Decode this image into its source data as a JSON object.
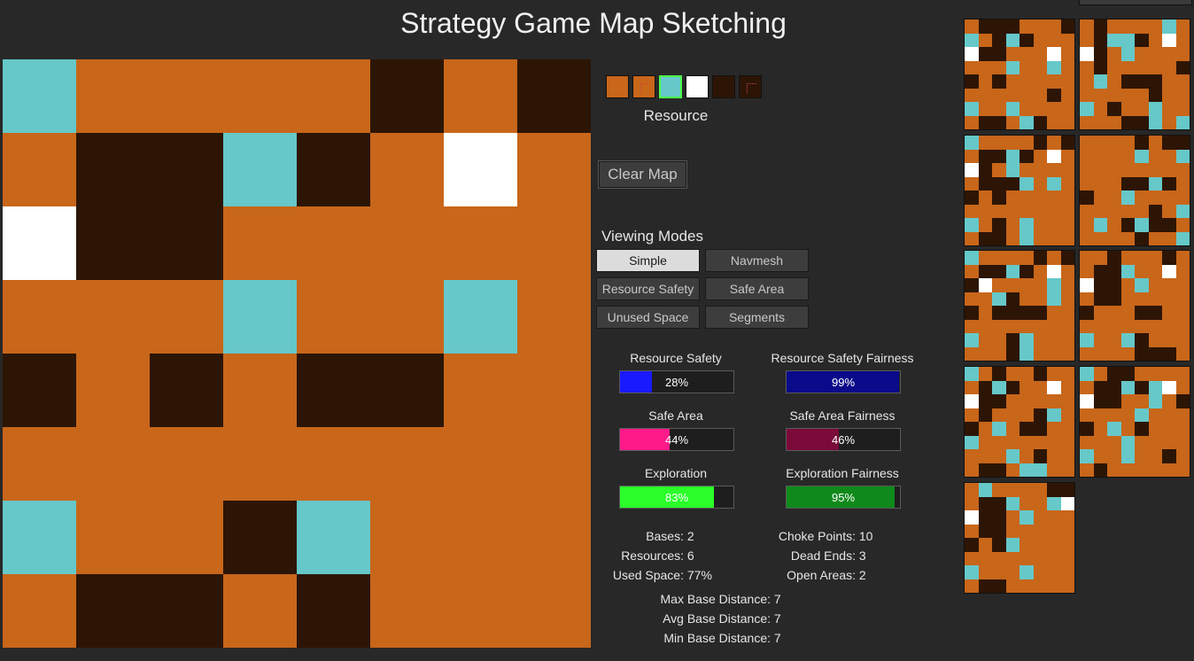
{
  "title": "Strategy Game Map Sketching",
  "tile_colors": {
    "O": "#c8661a",
    "D": "#2d1505",
    "C": "#66c8c8",
    "W": "#ffffff"
  },
  "main_map": [
    "COOOODOD",
    "ODDCDOWO",
    "WDDOOOOO",
    "OOOCOOCO",
    "DODODDOO",
    "OOOOOOOO",
    "COODCOOO",
    "ODDODOOO"
  ],
  "palette": {
    "label": "Resource",
    "tools": [
      {
        "name": "ground-tile",
        "color": "#c8661a",
        "selected": false,
        "marker": false
      },
      {
        "name": "ground-marker-tile",
        "color": "#c8661a",
        "selected": false,
        "marker": true
      },
      {
        "name": "resource-tile",
        "color": "#66c8c8",
        "selected": true,
        "marker": false
      },
      {
        "name": "base-tile",
        "color": "#ffffff",
        "selected": false,
        "marker": false
      },
      {
        "name": "wall-tile",
        "color": "#2d1505",
        "selected": false,
        "marker": false
      },
      {
        "name": "wall-marker-tile",
        "color": "#2d1505",
        "selected": false,
        "marker": true
      }
    ]
  },
  "clear_label": "Clear Map",
  "viewing_modes": {
    "label": "Viewing Modes",
    "buttons": [
      "Simple",
      "Navmesh",
      "Resource Safety",
      "Safe Area",
      "Unused Space",
      "Segments"
    ],
    "active": "Simple"
  },
  "metrics": [
    {
      "label": "Resource Safety",
      "value": 28,
      "text": "28%",
      "color": "#1a1aff"
    },
    {
      "label": "Resource Safety Fairness",
      "value": 99,
      "text": "99%",
      "color": "#0a0a8a"
    },
    {
      "label": "Safe Area",
      "value": 44,
      "text": "44%",
      "color": "#ff1a8a"
    },
    {
      "label": "Safe Area Fairness",
      "value": 46,
      "text": "46%",
      "color": "#7a0a3a"
    },
    {
      "label": "Exploration",
      "value": 83,
      "text": "83%",
      "color": "#2aff2a"
    },
    {
      "label": "Exploration Fairness",
      "value": 95,
      "text": "95%",
      "color": "#0f8a1a"
    }
  ],
  "stats_left": [
    {
      "k": "Bases:",
      "v": "2"
    },
    {
      "k": "Resources:",
      "v": "6"
    },
    {
      "k": "Used Space:",
      "v": "77%"
    }
  ],
  "stats_right": [
    {
      "k": "Choke Points:",
      "v": "10"
    },
    {
      "k": "Dead Ends:",
      "v": "3"
    },
    {
      "k": "Open Areas:",
      "v": "2"
    }
  ],
  "stats_bottom": [
    {
      "k": "Max Base Distance:",
      "v": "7"
    },
    {
      "k": "Avg Base Distance:",
      "v": "7"
    },
    {
      "k": "Min Base Distance:",
      "v": "7"
    }
  ],
  "thumbnails": [
    [
      "ODDDOOOD",
      "CODCDOOO",
      "WDDOOOWO",
      "OOOCOOCO",
      "DODOOOOO",
      "OOOOOODO",
      "COOCOOOO",
      "ODDOCDOO"
    ],
    [
      "ODOOOOCO",
      "ODCCDOWO",
      "WDOCOOOO",
      "ODOOOOOD",
      "OCODDDOO",
      "OOOOODOO",
      "CODOOCOO",
      "OOODDCOC"
    ],
    [
      "COOOODOD",
      "ODDCDOWO",
      "WDOCOOOO",
      "ODDDCOCO",
      "DODOOOOO",
      "OOOOOOOO",
      "CODOCOOO",
      "ODDOCOOO"
    ],
    [
      "OOOODODD",
      "OOOOCOOC",
      "OOOOOOOO",
      "OOODDCDO",
      "DOOCOOOO",
      "OOOOODOC",
      "OCODCDDO",
      "OOOODOOC"
    ],
    [
      "COOOODOD",
      "ODDCDOWO",
      "DWOOOOCO",
      "OOCDOOCO",
      "DODDDDOO",
      "OOOOOOOO",
      "COODCOOO",
      "OOODCOOO"
    ],
    [
      "OODOOODO",
      "ODDCOOWO",
      "WDDOCOOO",
      "ODDOOOOO",
      "DOOODDOO",
      "OOOOOOOO",
      "COOCDOOO",
      "OOOODDDO"
    ],
    [
      "CODOODOO",
      "ODCDOOWO",
      "WDDOOOOO",
      "ODOOODCO",
      "DOCODDOO",
      "COOOOOOO",
      "OOOCODOO",
      "ODDOCCOO"
    ],
    [
      "CODDOOOO",
      "ODDCDCWO",
      "WDDOOCOD",
      "OOOOCOOO",
      "DOCODOOO",
      "OOOCOOOO",
      "COOCOODO",
      "ODOOOOOO"
    ],
    [
      "OCOOOODD",
      "ODDCOOCW",
      "WDDOCOOO",
      "ODDOOOOO",
      "DODCOOOO",
      "OOOOOOOO",
      "COOOCOOO",
      "ODDOOOOO"
    ]
  ]
}
